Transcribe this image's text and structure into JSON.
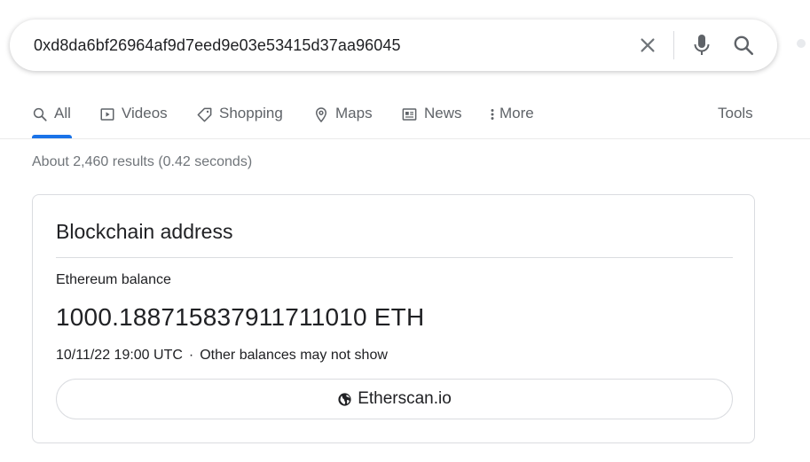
{
  "search": {
    "query": "0xd8da6bf26964af9d7eed9e03e53415d37aa96045",
    "icons": [
      "close-icon",
      "microphone-icon",
      "search-icon"
    ]
  },
  "tabs": [
    {
      "label": "All",
      "icon": "search-icon",
      "active": true
    },
    {
      "label": "Videos",
      "icon": "play-icon"
    },
    {
      "label": "Shopping",
      "icon": "tag-icon"
    },
    {
      "label": "Maps",
      "icon": "map-pin-icon"
    },
    {
      "label": "News",
      "icon": "newspaper-icon"
    },
    {
      "label": "More",
      "icon": "more-vertical-icon"
    }
  ],
  "tools_label": "Tools",
  "result_stats": "About 2,460 results (0.42 seconds)",
  "card": {
    "title": "Blockchain address",
    "balance_label": "Ethereum balance",
    "balance_value": "1000.188715837911711010 ETH",
    "timestamp": "10/11/22 19:00 UTC",
    "separator": "·",
    "note": "Other balances may not show",
    "link_label": "Etherscan.io",
    "link_icon": "globe-icon"
  },
  "colors": {
    "accent": "#1a73e8",
    "text_secondary": "#5f6368",
    "mic_blue": "#4285f4"
  }
}
